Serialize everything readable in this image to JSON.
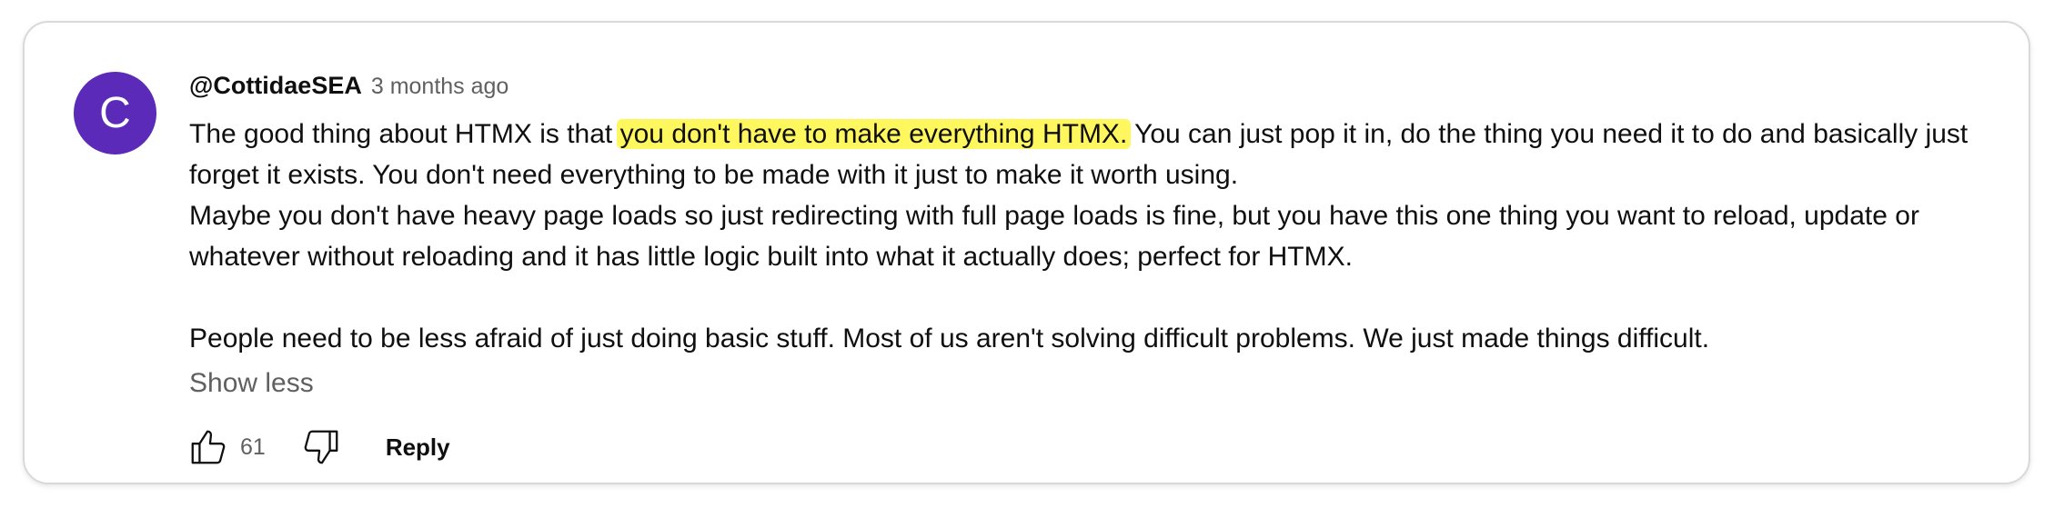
{
  "theme": {
    "avatar_color": "#5c2ab8",
    "highlight_color": "#fff75e"
  },
  "comment": {
    "avatar_letter": "C",
    "author": "@CottidaeSEA",
    "timestamp": "3 months ago",
    "paragraph1_before": "The good thing about HTMX is that",
    "paragraph1_highlight": "you don't have to make everything HTMX.",
    "paragraph1_after": " You can just pop it in, do the thing you need it to do and basically just forget it exists. You don't need everything to be made with it just to make it worth using.",
    "paragraph2": "Maybe you don't have heavy page loads so just redirecting with full page loads is fine, but you have this one thing you want to reload, update or whatever without reloading and it has little logic built into what it actually does; perfect for HTMX.",
    "paragraph3": "People need to be less afraid of just doing basic stuff. Most of us aren't solving difficult problems. We just made things difficult.",
    "show_less_label": "Show less",
    "like_count": "61",
    "reply_label": "Reply",
    "icons": {
      "like": "thumbs-up-icon",
      "dislike": "thumbs-down-icon"
    }
  }
}
